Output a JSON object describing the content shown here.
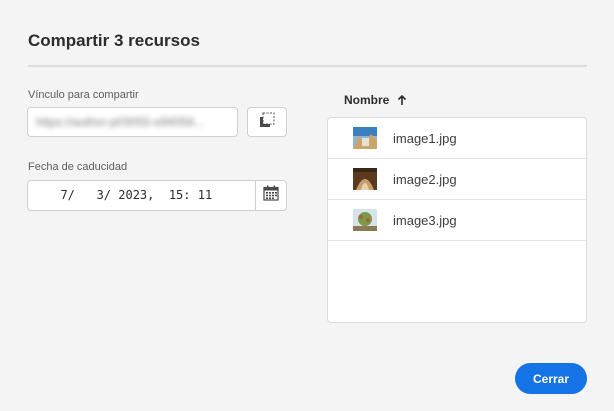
{
  "dialog": {
    "title": "Compartir 3 recursos"
  },
  "share_link": {
    "label": "Vínculo para compartir",
    "value": "https://author-p03055-e94056...",
    "copy_icon": "copy-icon"
  },
  "expiration": {
    "label": "Fecha de caducidad",
    "value": "  7/   3/ 2023,  15: 11",
    "calendar_icon": "calendar-icon"
  },
  "file_list": {
    "column_header": "Nombre",
    "sort_icon": "arrow-up-icon",
    "items": [
      {
        "name": "image1.jpg",
        "thumb_colors": [
          "#3a7fbf",
          "#8fb6d8",
          "#c9a56b"
        ]
      },
      {
        "name": "image2.jpg",
        "thumb_colors": [
          "#5a3b22",
          "#c9a06a",
          "#e6d3b0"
        ]
      },
      {
        "name": "image3.jpg",
        "thumb_colors": [
          "#d8e2ea",
          "#7a9a4a",
          "#b25b3b"
        ]
      }
    ]
  },
  "footer": {
    "close_label": "Cerrar"
  },
  "colors": {
    "accent": "#1473e6",
    "background": "#f4f4f4"
  }
}
